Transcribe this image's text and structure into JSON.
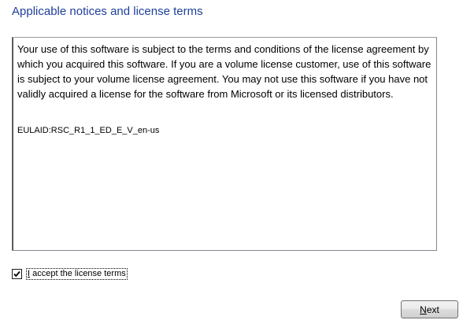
{
  "page": {
    "title": "Applicable notices and license terms"
  },
  "license": {
    "text": "Your use of this software is subject to the terms and conditions of the license agreement by which you acquired this software.  If you are a volume license customer, use of this software is subject to your volume license agreement.  You may not use this software if you have not validly acquired a license for the software from Microsoft or its licensed distributors.",
    "eula_id": "EULAID:RSC_R1_1_ED_E_V_en-us"
  },
  "accept": {
    "checked": true,
    "label_access_key": "I",
    "label_rest": " accept the license terms"
  },
  "buttons": {
    "next_access_key": "N",
    "next_rest": "ext"
  },
  "colors": {
    "title": "#1e3f9b",
    "box_border": "#828790"
  }
}
